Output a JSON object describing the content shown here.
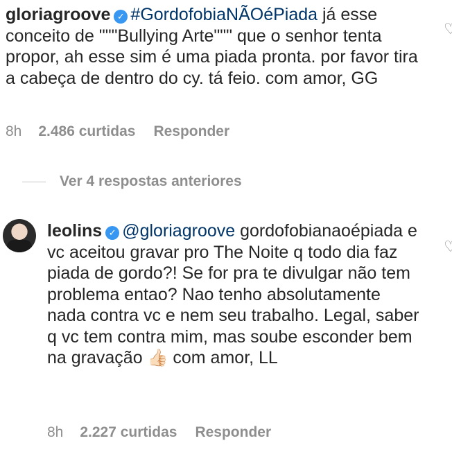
{
  "comments": [
    {
      "username": "gloriagroove",
      "verified": true,
      "hashtag": "#GordofobiaNÃOéPiada",
      "text": " já esse conceito de \"\"\"Bullying Arte\"\"\" que o senhor tenta propor, ah esse sim é uma piada pronta. por favor tira a cabeça de dentro do cy. tá feio. com amor, GG",
      "time": "8h",
      "likes": "2.486 curtidas",
      "reply_label": "Responder"
    },
    {
      "username": "leolins",
      "verified": true,
      "mention": "@gloriagroove",
      "text": " gordofobianaoépiada e vc aceitou gravar pro The Noite q todo dia faz piada de gordo?! Se for pra te divulgar não tem problema entao? Nao tenho absolutamente nada contra vc e nem seu trabalho. Legal, saber q vc tem contra mim, mas soube esconder bem na gravação ",
      "emoji": "👍🏻",
      "text_end": " com amor, LL",
      "time": "8h",
      "likes": "2.227 curtidas",
      "reply_label": "Responder"
    }
  ],
  "view_replies_label": "Ver 4 respostas anteriores",
  "icons": {
    "like": "heart-icon",
    "verified": "verified-badge-icon"
  },
  "colors": {
    "verified": "#3897f0",
    "link": "#003569",
    "meta": "#8e8e8e"
  }
}
